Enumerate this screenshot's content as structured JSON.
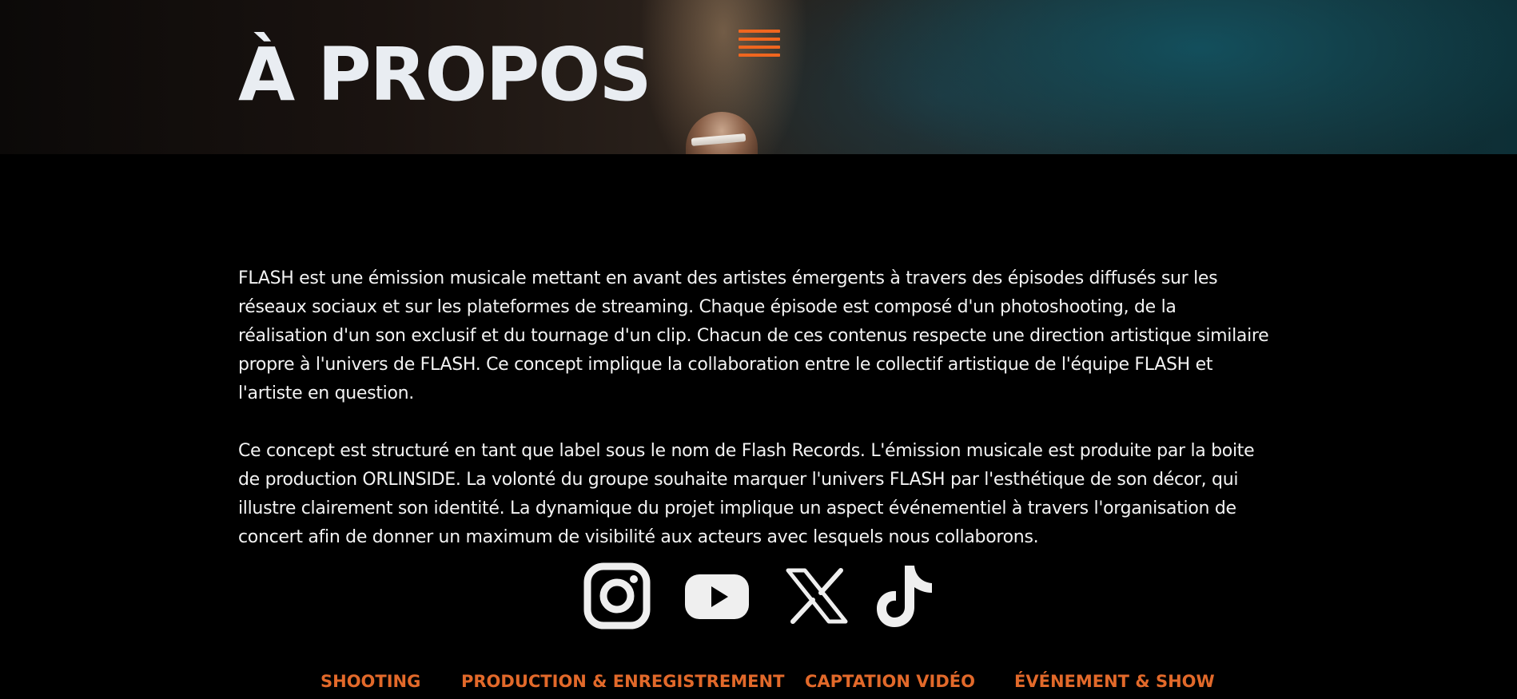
{
  "hero": {
    "title": "À PROPOS"
  },
  "header": {
    "menu_icon": "hamburger-menu-icon",
    "accent_color": "#f0661f"
  },
  "content": {
    "paragraphs": [
      "FLASH est une émission musicale mettant en avant des artistes émergents à travers des épisodes diffusés sur les réseaux sociaux et sur les plateformes de streaming. Chaque épisode est composé d'un photoshooting, de la réalisation d'un son exclusif et du tournage d'un clip. Chacun de ces contenus respecte une direction artistique similaire propre à l'univers de FLASH. Ce concept implique la collaboration entre le collectif artistique de l'équipe FLASH et l'artiste en question.",
      "Ce concept est structuré en tant que label sous le nom de Flash Records. L'émission musicale est produite par la boite de production ORLINSIDE. La volonté du groupe souhaite marquer l'univers FLASH par l'esthétique de son décor, qui illustre clairement son identité. La dynamique du projet implique un aspect événementiel à travers l'organisation de concert afin de donner un maximum de visibilité aux acteurs avec lesquels nous collaborons."
    ]
  },
  "socials": [
    {
      "icon": "instagram-icon"
    },
    {
      "icon": "youtube-icon"
    },
    {
      "icon": "x-icon"
    },
    {
      "icon": "tiktok-icon"
    }
  ],
  "footer_nav": {
    "color": "#e2692a",
    "items": [
      {
        "label": "SHOOTING"
      },
      {
        "label": "PRODUCTION & ENREGISTREMENT"
      },
      {
        "label": "CAPTATION VIDÉO"
      },
      {
        "label": "ÉVÉNEMENT & SHOW"
      }
    ]
  }
}
